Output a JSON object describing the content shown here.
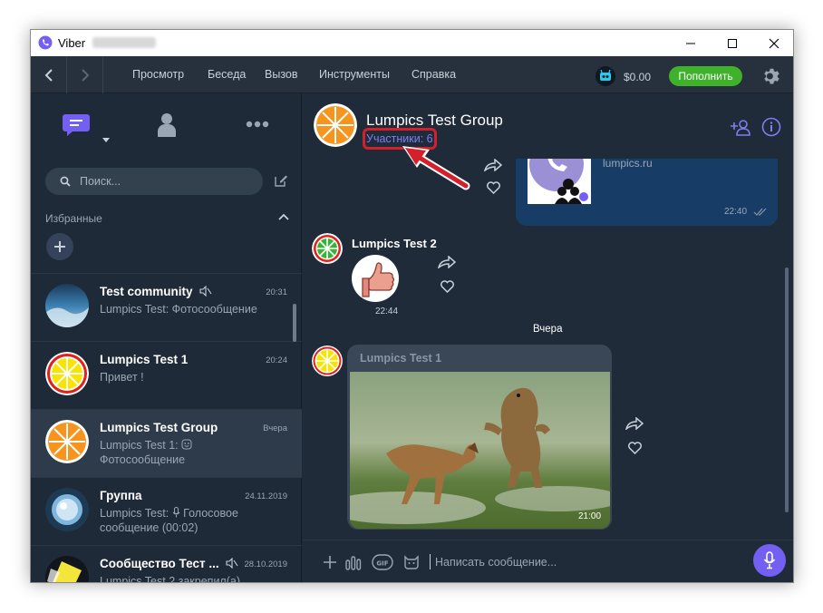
{
  "window": {
    "title": "Viber"
  },
  "menu": {
    "items": [
      "Просмотр",
      "Беседа",
      "Вызов",
      "Инструменты",
      "Справка"
    ],
    "balance": "$0.00",
    "topup_label": "Пополнить"
  },
  "sidebar": {
    "search_placeholder": "Поиск...",
    "favorites_label": "Избранные",
    "chats": [
      {
        "name": "Test community",
        "time": "20:31",
        "preview": "Lumpics Test: Фотосообщение",
        "muted": true
      },
      {
        "name": "Lumpics Test 1",
        "time": "20:24",
        "preview": "Привет !",
        "muted": false
      },
      {
        "name": "Lumpics Test Group",
        "time": "Вчера",
        "preview_line1": "Lumpics Test 1: ",
        "preview_line2": "Фотосообщение",
        "muted": false
      },
      {
        "name": "Группа",
        "time": "24.11.2019",
        "preview_line1": "Lumpics Test: ",
        "preview_line1b": "Голосовое",
        "preview_line2": "сообщение (00:02)",
        "muted": false
      },
      {
        "name": "Сообщество Тест ...",
        "time": "28.10.2019",
        "preview": "Lumpics Test 2 закрепил(а)",
        "muted": true
      }
    ]
  },
  "conversation": {
    "title": "Lumpics Test Group",
    "members_link": "Участники: 6",
    "messages": {
      "outgoing_link": "lumpics.ru",
      "outgoing_time": "22:40",
      "sticker_sender": "Lumpics Test 2",
      "sticker_time": "22:44",
      "date_separator": "Вчера",
      "photo_sender": "Lumpics Test 1",
      "photo_time": "21:00"
    },
    "composer_placeholder": "Написать сообщение..."
  },
  "colors": {
    "accent": "#7360f2",
    "topup": "#3fb12b",
    "highlight": "#d4202a",
    "members_link": "#7d7ff4"
  }
}
